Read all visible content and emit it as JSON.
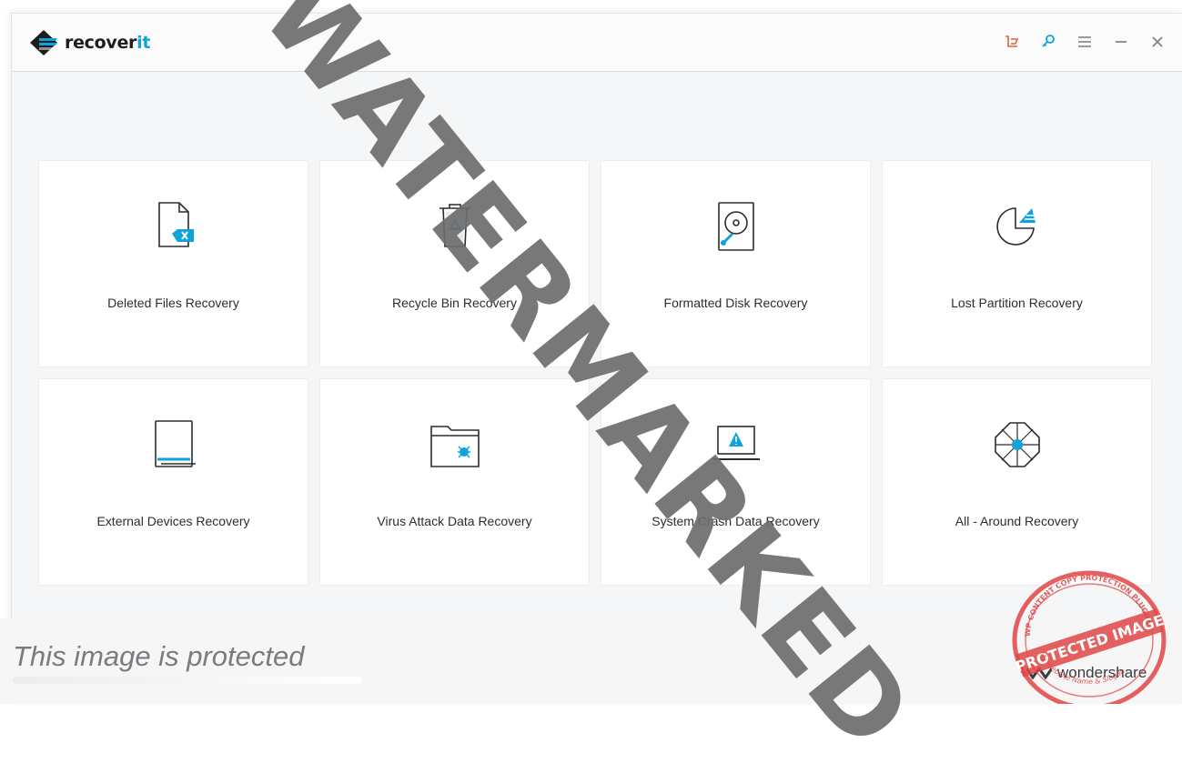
{
  "app": {
    "name_prefix": "recover",
    "name_accent": "it",
    "brand_color": "#0fa3dc"
  },
  "titlebar": {
    "controls": [
      {
        "icon": "cart-icon",
        "color": "#e8623a"
      },
      {
        "icon": "key-icon",
        "color": "#0fa3dc"
      },
      {
        "icon": "menu-icon",
        "color": "#777a80"
      },
      {
        "icon": "minimize-icon",
        "color": "#777a80"
      },
      {
        "icon": "close-icon",
        "color": "#777a80"
      }
    ]
  },
  "modes": [
    {
      "label": "Deleted Files Recovery",
      "icon": "deleted-file-icon"
    },
    {
      "label": "Recycle Bin Recovery",
      "icon": "recycle-bin-icon"
    },
    {
      "label": "Formatted Disk Recovery",
      "icon": "hard-disk-icon"
    },
    {
      "label": "Lost Partition Recovery",
      "icon": "partition-pie-icon"
    },
    {
      "label": "External Devices Recovery",
      "icon": "external-drive-icon"
    },
    {
      "label": "Virus Attack Data Recovery",
      "icon": "virus-folder-icon"
    },
    {
      "label": "System Crash Data Recovery",
      "icon": "crashed-laptop-icon"
    },
    {
      "label": "All - Around Recovery",
      "icon": "all-around-icon"
    }
  ],
  "overlay": {
    "watermark": "WATERMARKED",
    "protected_text": "This image is protected",
    "vendor": "wondershare",
    "stamp_text": "PROTECTED IMAGE",
    "stamp_arc_top": "WP CONTENT COPY PROTECTION PLUGIN",
    "stamp_arc_bottom": "My Website Name & Slogan",
    "stamp_color": "#e04545"
  }
}
